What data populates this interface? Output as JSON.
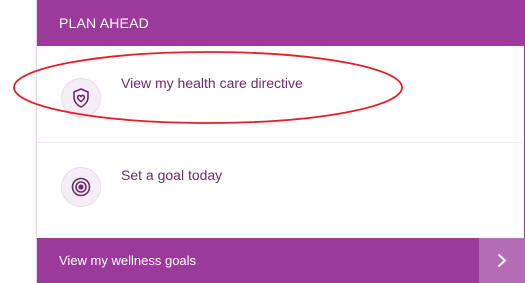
{
  "card": {
    "header_title": "PLAN AHEAD",
    "items": [
      {
        "label": "View my health care directive",
        "icon": "shield-heart-icon"
      },
      {
        "label": "Set a goal today",
        "icon": "target-icon"
      }
    ],
    "footer_label": "View my wellness goals",
    "footer_icon": "chevron-right-icon"
  },
  "annotation": {
    "shape": "ellipse",
    "color": "#e0202a"
  },
  "colors": {
    "accent": "#9c3a9b",
    "accent_light": "#b56cb6",
    "text": "#6d2a6c",
    "icon_bg": "#f6eef6"
  }
}
